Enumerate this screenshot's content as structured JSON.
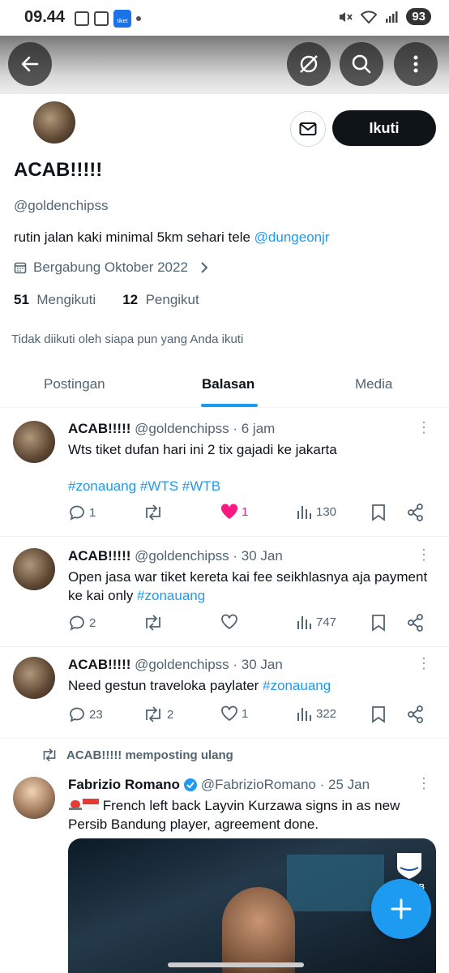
{
  "status": {
    "time": "09.44",
    "tiket_label": "tiket",
    "battery": "93"
  },
  "profile": {
    "name": "ACAB!!!!!",
    "handle": "@goldenchipss",
    "bio_text": "rutin jalan kaki minimal 5km sehari  tele ",
    "bio_link": "@dungeonjr",
    "joined": "Bergabung Oktober 2022",
    "following_count": "51",
    "following_label": "Mengikuti",
    "followers_count": "12",
    "followers_label": "Pengikut",
    "not_followed": "Tidak diikuti oleh siapa pun yang Anda ikuti",
    "follow_label": "Ikuti"
  },
  "tabs": [
    {
      "label": "Postingan"
    },
    {
      "label": "Balasan"
    },
    {
      "label": "Media"
    }
  ],
  "posts": [
    {
      "name": "ACAB!!!!!",
      "meta": "@goldenchipss · 6 jam",
      "text": "Wts tiket dufan hari ini 2 tix gajadi ke jakarta",
      "tags": "#zonauang #WTS #WTB",
      "replies": "1",
      "reposts": "",
      "likes": "1",
      "views": "130",
      "liked": true
    },
    {
      "name": "ACAB!!!!!",
      "meta": "@goldenchipss · 30 Jan",
      "text": "Open jasa war tiket kereta kai fee seikhlasnya aja payment ke kai only ",
      "tag": "#zonauang",
      "replies": "2",
      "reposts": "",
      "likes": "",
      "views": "747"
    },
    {
      "name": "ACAB!!!!!",
      "meta": "@goldenchipss · 30 Jan",
      "text": "Need gestun traveloka paylater ",
      "tag": "#zonauang",
      "replies": "23",
      "reposts": "2",
      "likes": "1",
      "views": "322"
    }
  ],
  "repost": {
    "label": "ACAB!!!!! memposting ulang",
    "name": "Fabrizio Romano",
    "meta": "@FabrizioRomano · 25 Jan",
    "text": "French left back Layvin Kurzawa signs in as new Persib Bandung player, agreement done.",
    "badge": "PERSIB"
  },
  "colors": {
    "accent": "#1d9bf0",
    "like": "#f91880",
    "text": "#0f1419",
    "muted": "#536471"
  }
}
